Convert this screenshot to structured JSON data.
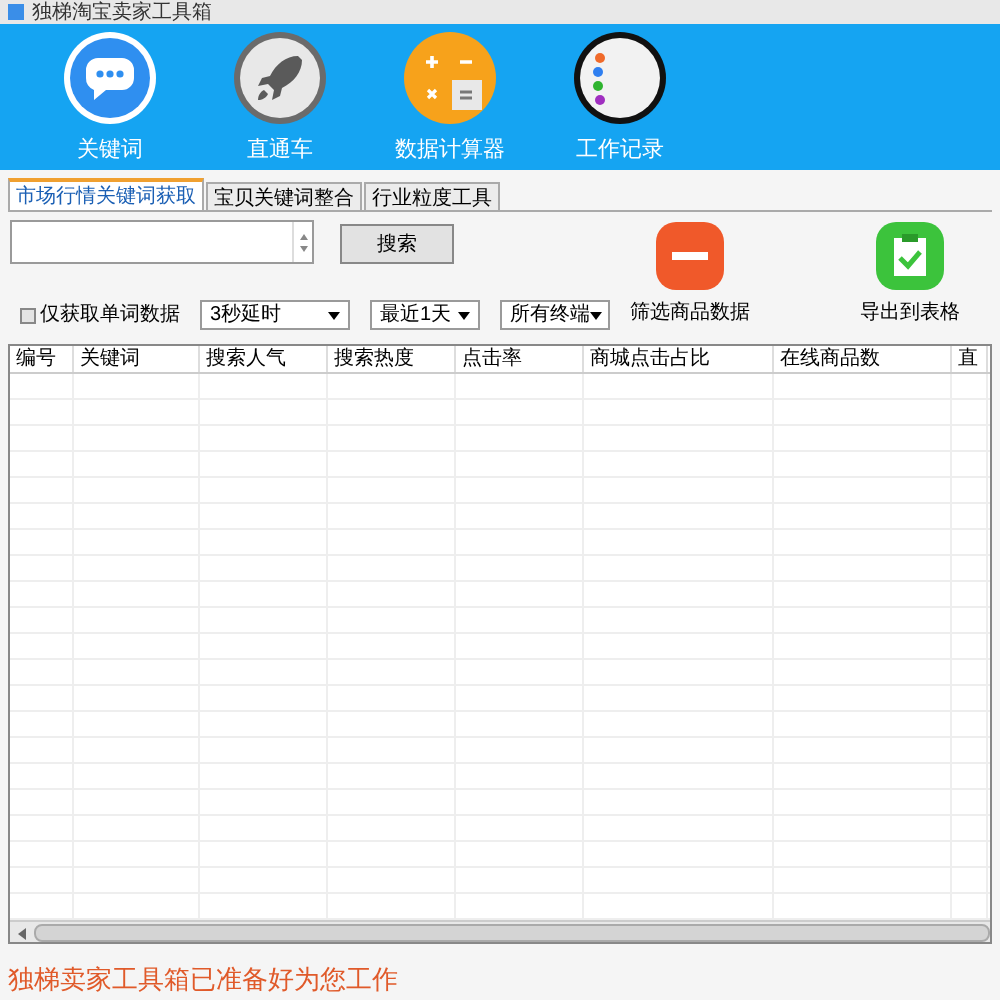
{
  "window": {
    "title": "独梯淘宝卖家工具箱"
  },
  "toolbar": [
    {
      "kind": "chat",
      "label": "关键词"
    },
    {
      "kind": "rocket",
      "label": "直通车"
    },
    {
      "kind": "calculator",
      "label": "数据计算器"
    },
    {
      "kind": "notes",
      "label": "工作记录"
    }
  ],
  "tabs": [
    {
      "label": "市场行情关键词获取",
      "selected": true
    },
    {
      "label": "宝贝关键词整合",
      "selected": false
    },
    {
      "label": "行业粒度工具",
      "selected": false
    }
  ],
  "search": {
    "button": "搜索"
  },
  "single_word_only": {
    "label": "仅获取单词数据",
    "checked": false
  },
  "dropdowns": [
    "3秒延时",
    "最近1天",
    "所有终端"
  ],
  "actions": [
    {
      "kind": "filter",
      "label": "筛选商品数据"
    },
    {
      "kind": "export",
      "label": "导出到表格"
    }
  ],
  "table": {
    "columns": [
      "编号",
      "关键词",
      "搜索人气",
      "搜索热度",
      "点击率",
      "商城点击占比",
      "在线商品数",
      "直"
    ]
  },
  "status_bar": "独梯卖家工具箱已准备好为您工作"
}
